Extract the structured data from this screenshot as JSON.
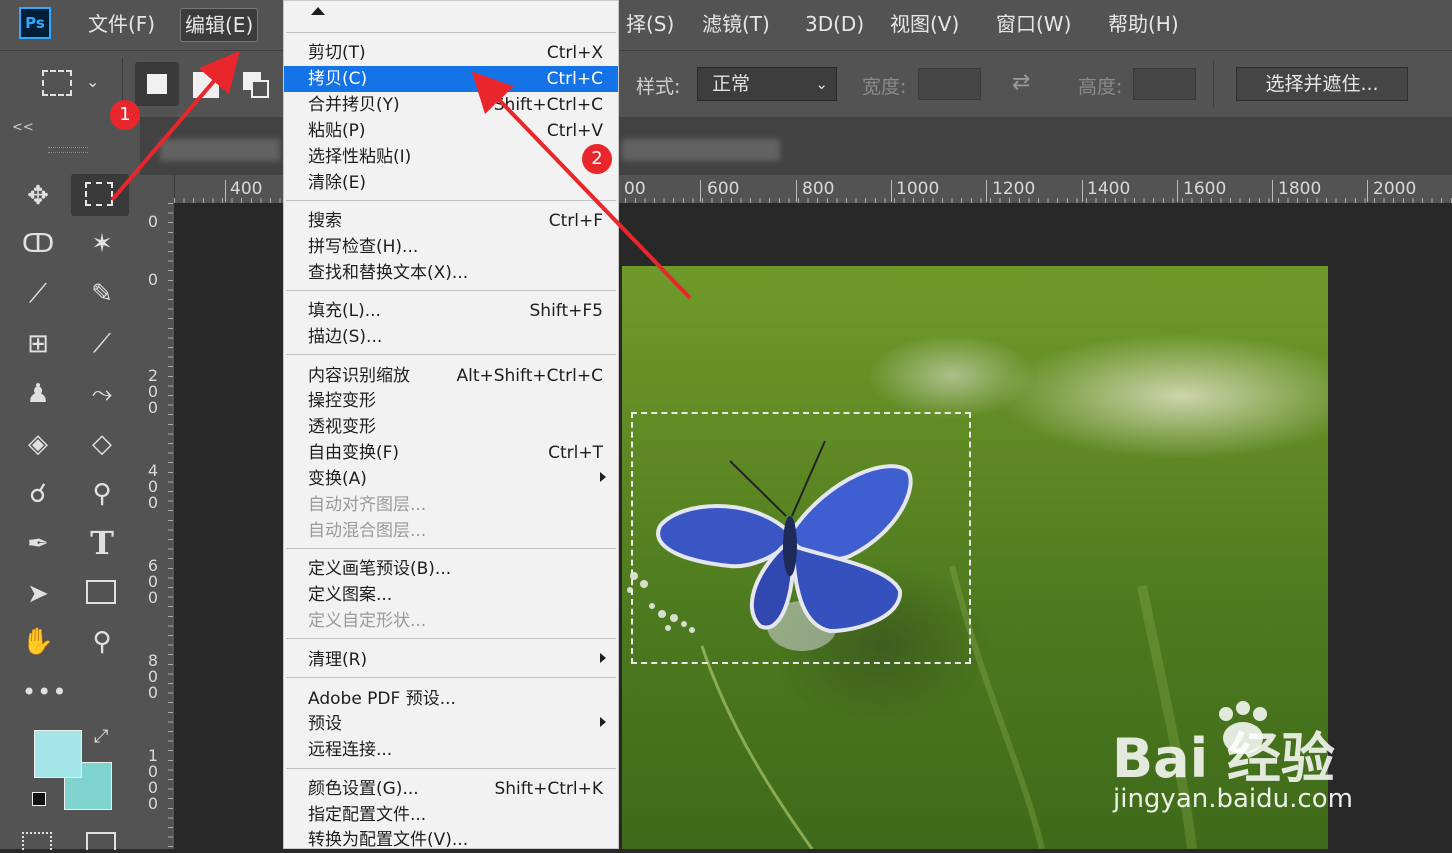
{
  "menubar": {
    "logo": "Ps",
    "items": [
      {
        "label": "文件(F)"
      },
      {
        "label": "编辑(E)"
      },
      {
        "label": "择(S)"
      },
      {
        "label": "滤镜(T)"
      },
      {
        "label": "3D(D)"
      },
      {
        "label": "视图(V)"
      },
      {
        "label": "窗口(W)"
      },
      {
        "label": "帮助(H)"
      }
    ]
  },
  "options": {
    "style_label": "样式:",
    "style_value": "正常",
    "width_label": "宽度:",
    "height_label": "高度:",
    "select_mask_button": "选择并遮住..."
  },
  "ruler": {
    "h_ticks": [
      "400",
      "00",
      "600",
      "800",
      "1000",
      "1200",
      "1400",
      "1600",
      "1800",
      "2000"
    ],
    "v_ticks": [
      "0",
      "0",
      "200",
      "400",
      "600",
      "800",
      "1000"
    ]
  },
  "edit_menu": {
    "groups": [
      [
        {
          "label": "剪切(T)",
          "shortcut": "Ctrl+X"
        },
        {
          "label": "拷贝(C)",
          "shortcut": "Ctrl+C",
          "highlight": true
        },
        {
          "label": "合并拷贝(Y)",
          "shortcut": "Shift+Ctrl+C"
        },
        {
          "label": "粘贴(P)",
          "shortcut": "Ctrl+V"
        },
        {
          "label": "选择性粘贴(I)",
          "shortcut": ""
        },
        {
          "label": "清除(E)",
          "shortcut": ""
        }
      ],
      [
        {
          "label": "搜索",
          "shortcut": "Ctrl+F"
        },
        {
          "label": "拼写检查(H)...",
          "shortcut": ""
        },
        {
          "label": "查找和替换文本(X)...",
          "shortcut": ""
        }
      ],
      [
        {
          "label": "填充(L)...",
          "shortcut": "Shift+F5"
        },
        {
          "label": "描边(S)...",
          "shortcut": ""
        }
      ],
      [
        {
          "label": "内容识别缩放",
          "shortcut": "Alt+Shift+Ctrl+C"
        },
        {
          "label": "操控变形",
          "shortcut": ""
        },
        {
          "label": "透视变形",
          "shortcut": ""
        },
        {
          "label": "自由变换(F)",
          "shortcut": "Ctrl+T"
        },
        {
          "label": "变换(A)",
          "shortcut": "",
          "submenu": true
        },
        {
          "label": "自动对齐图层...",
          "shortcut": "",
          "disabled": true
        },
        {
          "label": "自动混合图层...",
          "shortcut": "",
          "disabled": true
        }
      ],
      [
        {
          "label": "定义画笔预设(B)...",
          "shortcut": ""
        },
        {
          "label": "定义图案...",
          "shortcut": ""
        },
        {
          "label": "定义自定形状...",
          "shortcut": "",
          "disabled": true
        }
      ],
      [
        {
          "label": "清理(R)",
          "shortcut": "",
          "submenu": true
        }
      ],
      [
        {
          "label": "Adobe PDF 预设...",
          "shortcut": ""
        },
        {
          "label": "预设",
          "shortcut": "",
          "submenu": true
        },
        {
          "label": "远程连接...",
          "shortcut": ""
        }
      ],
      [
        {
          "label": "颜色设置(G)...",
          "shortcut": "Shift+Ctrl+K"
        },
        {
          "label": "指定配置文件...",
          "shortcut": ""
        },
        {
          "label": "转换为配置文件(V)...",
          "shortcut": ""
        }
      ]
    ]
  },
  "annotations": {
    "badge1": "1",
    "badge2": "2",
    "arrow_color": "#e8262c"
  },
  "watermark": {
    "main": "Bai 经验",
    "sub": "jingyan.baidu.com"
  },
  "toolbar": {
    "collapse": "<<",
    "type_tool": "T"
  }
}
